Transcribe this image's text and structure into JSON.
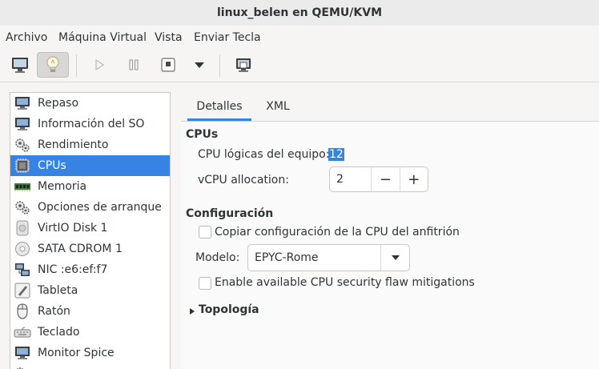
{
  "window": {
    "title": "linux_belen en QEMU/KVM"
  },
  "menu": [
    "Archivo",
    "Máquina Virtual",
    "Vista",
    "Enviar Tecla"
  ],
  "toolbar": {
    "icons": [
      "monitor-icon",
      "lightbulb-icon",
      "play-icon",
      "pause-icon",
      "power-icon",
      "dropdown-arrow-icon",
      "snapshot-icon"
    ]
  },
  "sidebar": {
    "items": [
      {
        "label": "Repaso",
        "icon": "monitor-icon"
      },
      {
        "label": "Información del SO",
        "icon": "monitor-icon"
      },
      {
        "label": "Rendimiento",
        "icon": "gears-icon"
      },
      {
        "label": "CPUs",
        "icon": "cpu-chip-icon",
        "selected": true
      },
      {
        "label": "Memoria",
        "icon": "memory-icon"
      },
      {
        "label": "Opciones de arranque",
        "icon": "gears-icon"
      },
      {
        "label": "VirtIO Disk 1",
        "icon": "disk-icon"
      },
      {
        "label": "SATA CDROM 1",
        "icon": "cdrom-icon"
      },
      {
        "label": "NIC :e6:ef:f7",
        "icon": "network-icon"
      },
      {
        "label": "Tableta",
        "icon": "tablet-icon"
      },
      {
        "label": "Ratón",
        "icon": "mouse-icon"
      },
      {
        "label": "Teclado",
        "icon": "keyboard-icon"
      },
      {
        "label": "Monitor Spice",
        "icon": "monitor-icon"
      }
    ]
  },
  "tabs": [
    "Detalles",
    "XML"
  ],
  "details": {
    "cpus_heading": "CPUs",
    "host_cpus_label": "CPU lógicas del equipo:",
    "host_cpus_value": "12",
    "vcpu_label": "vCPU allocation:",
    "vcpu_value": "2",
    "minus": "−",
    "plus": "+",
    "config_heading": "Configuración",
    "copy_host_label": "Copiar configuración de la CPU del anfitrión",
    "model_label": "Modelo:",
    "model_value": "EPYC-Rome",
    "mitigations_label": "Enable available CPU security flaw mitigations",
    "topology_label": "Topología"
  },
  "colors": {
    "accent": "#3584e4",
    "background": "#f6f5f4",
    "panel": "#fafafa"
  }
}
